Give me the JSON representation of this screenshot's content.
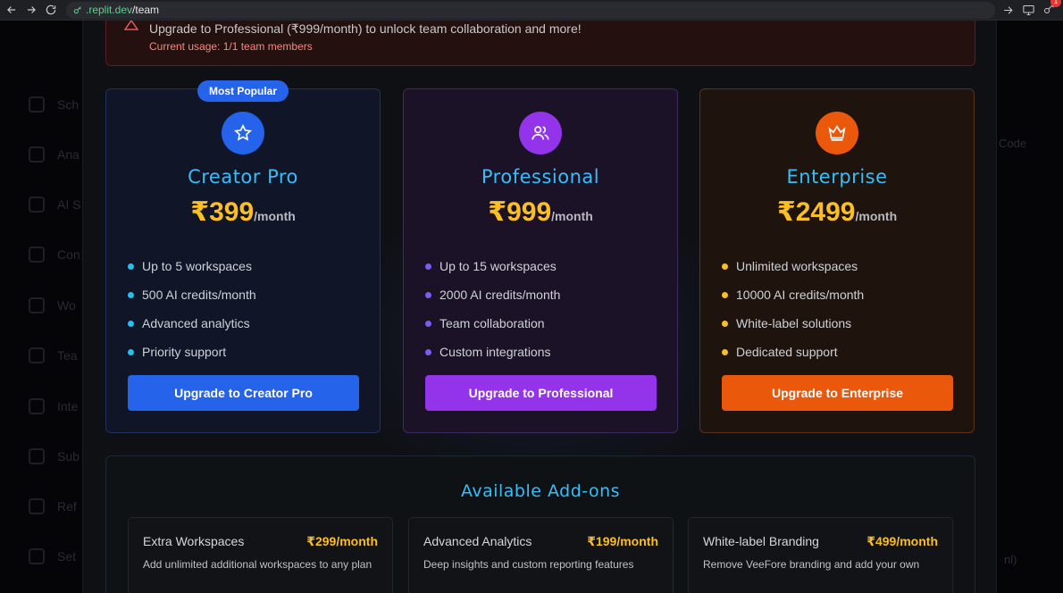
{
  "browser": {
    "url_domain": ".replit.dev",
    "url_path": "/team",
    "ext_badge": "1"
  },
  "background": {
    "sidebar": [
      "Sch",
      "Ana",
      "AI S",
      "Con",
      "Wo",
      "Tea",
      "Inte",
      "Sub",
      "Ref",
      "Set"
    ],
    "right_code": "Code",
    "right_ml": "nl)"
  },
  "alert": {
    "title": "Upgrade to Professional (₹999/month) to unlock team collaboration and more!",
    "usage": "Current usage: 1/1 team members"
  },
  "plans": [
    {
      "badge": "Most Popular",
      "icon": "star-icon",
      "name": "Creator Pro",
      "price": "₹399",
      "period": "/month",
      "features": [
        "Up to 5 workspaces",
        "500 AI credits/month",
        "Advanced analytics",
        "Priority support"
      ],
      "button": "Upgrade to Creator Pro",
      "color": "#2563eb"
    },
    {
      "icon": "users-icon",
      "name": "Professional",
      "price": "₹999",
      "period": "/month",
      "features": [
        "Up to 15 workspaces",
        "2000 AI credits/month",
        "Team collaboration",
        "Custom integrations"
      ],
      "button": "Upgrade to Professional",
      "color": "#9333ea"
    },
    {
      "icon": "crown-icon",
      "name": "Enterprise",
      "price": "₹2499",
      "period": "/month",
      "features": [
        "Unlimited workspaces",
        "10000 AI credits/month",
        "White-label solutions",
        "Dedicated support"
      ],
      "button": "Upgrade to Enterprise",
      "color": "#ea580c"
    }
  ],
  "addons": {
    "title": "Available Add-ons",
    "items": [
      {
        "name": "Extra Workspaces",
        "price": "₹299/month",
        "desc": "Add unlimited additional workspaces to any plan"
      },
      {
        "name": "Advanced Analytics",
        "price": "₹199/month",
        "desc": "Deep insights and custom reporting features"
      },
      {
        "name": "White-label Branding",
        "price": "₹499/month",
        "desc": "Remove VeeFore branding and add your own"
      }
    ]
  },
  "colors": {
    "accent_title": "#38bdf8",
    "price": "#fbbf24"
  }
}
